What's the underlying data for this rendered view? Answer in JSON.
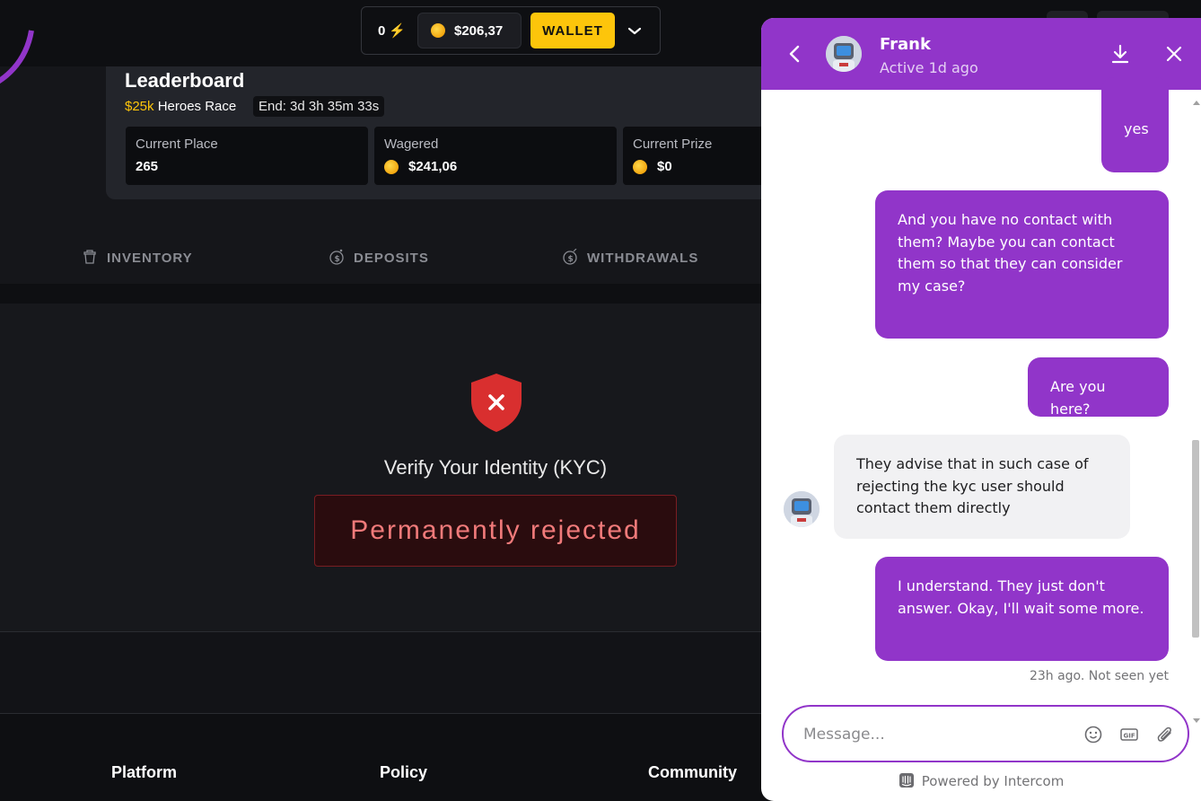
{
  "topbar": {
    "points": "0",
    "balance": "$206,37",
    "wallet_label": "WALLET"
  },
  "leaderboard": {
    "title": "Leaderboard",
    "race_amount": "$25k",
    "race_name": "Heroes Race",
    "end_time": "End: 3d 3h 35m 33s",
    "stats": [
      {
        "label": "Current Place",
        "value": "265"
      },
      {
        "label": "Wagered",
        "value": "$241,06"
      },
      {
        "label": "Current Prize",
        "value": "$0"
      }
    ]
  },
  "tabs": [
    "INVENTORY",
    "DEPOSITS",
    "WITHDRAWALS"
  ],
  "kyc": {
    "title": "Verify Your Identity (KYC)",
    "status": "Permanently rejected"
  },
  "footer": {
    "columns": [
      "Platform",
      "Policy",
      "Community"
    ]
  },
  "chat": {
    "agent_name": "Frank",
    "agent_status": "Active 1d ago",
    "messages": [
      {
        "from": "user",
        "text": "yes"
      },
      {
        "from": "user",
        "text": "And you have no contact with them? Maybe you can contact them so that they can consider my case?"
      },
      {
        "from": "user",
        "text": "Are you here?"
      },
      {
        "from": "agent",
        "text": "They advise that in such case of rejecting the kyc user should contact them directly"
      },
      {
        "from": "user",
        "text": "I understand. They just don't answer. Okay, I'll wait some more."
      }
    ],
    "seen_status": "23h ago. Not seen yet",
    "composer_placeholder": "Message...",
    "powered_by": "Powered by Intercom"
  },
  "colors": {
    "accent_purple": "#9135c9",
    "wallet_yellow": "#fdc50b",
    "reject_red": "#f07a7a"
  },
  "icons": [
    "lightning-icon",
    "coin-icon",
    "chevron-down-icon",
    "inventory-icon",
    "deposit-icon",
    "withdraw-icon",
    "shield-x-icon",
    "back-icon",
    "download-icon",
    "close-icon",
    "emoji-icon",
    "gif-icon",
    "attachment-icon",
    "intercom-logo"
  ]
}
